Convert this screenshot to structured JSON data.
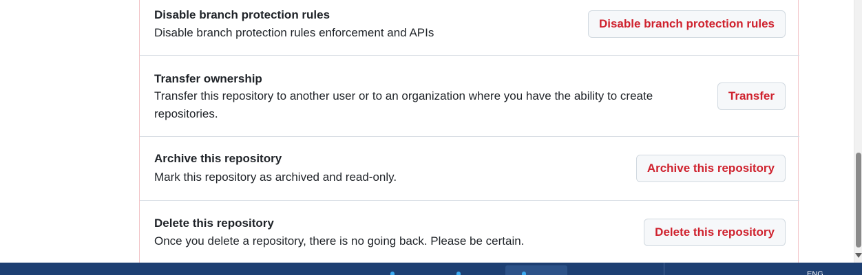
{
  "danger_zone": {
    "rows": [
      {
        "title": "Disable branch protection rules",
        "description": "Disable branch protection rules enforcement and APIs",
        "button": "Disable branch protection rules"
      },
      {
        "title": "Transfer ownership",
        "description": "Transfer this repository to another user or to an organization where you have the ability to create repositories.",
        "button": "Transfer"
      },
      {
        "title": "Archive this repository",
        "description": "Mark this repository as archived and read-only.",
        "button": "Archive this repository"
      },
      {
        "title": "Delete this repository",
        "description": "Once you delete a repository, there is no going back. Please be certain.",
        "button": "Delete this repository"
      }
    ]
  },
  "taskbar": {
    "language": "ENG"
  },
  "colors": {
    "danger_text": "#cf222e",
    "danger_border": "#f2c4c8",
    "button_bg": "#f6f8fa",
    "taskbar_bg": "#1d3f72"
  }
}
